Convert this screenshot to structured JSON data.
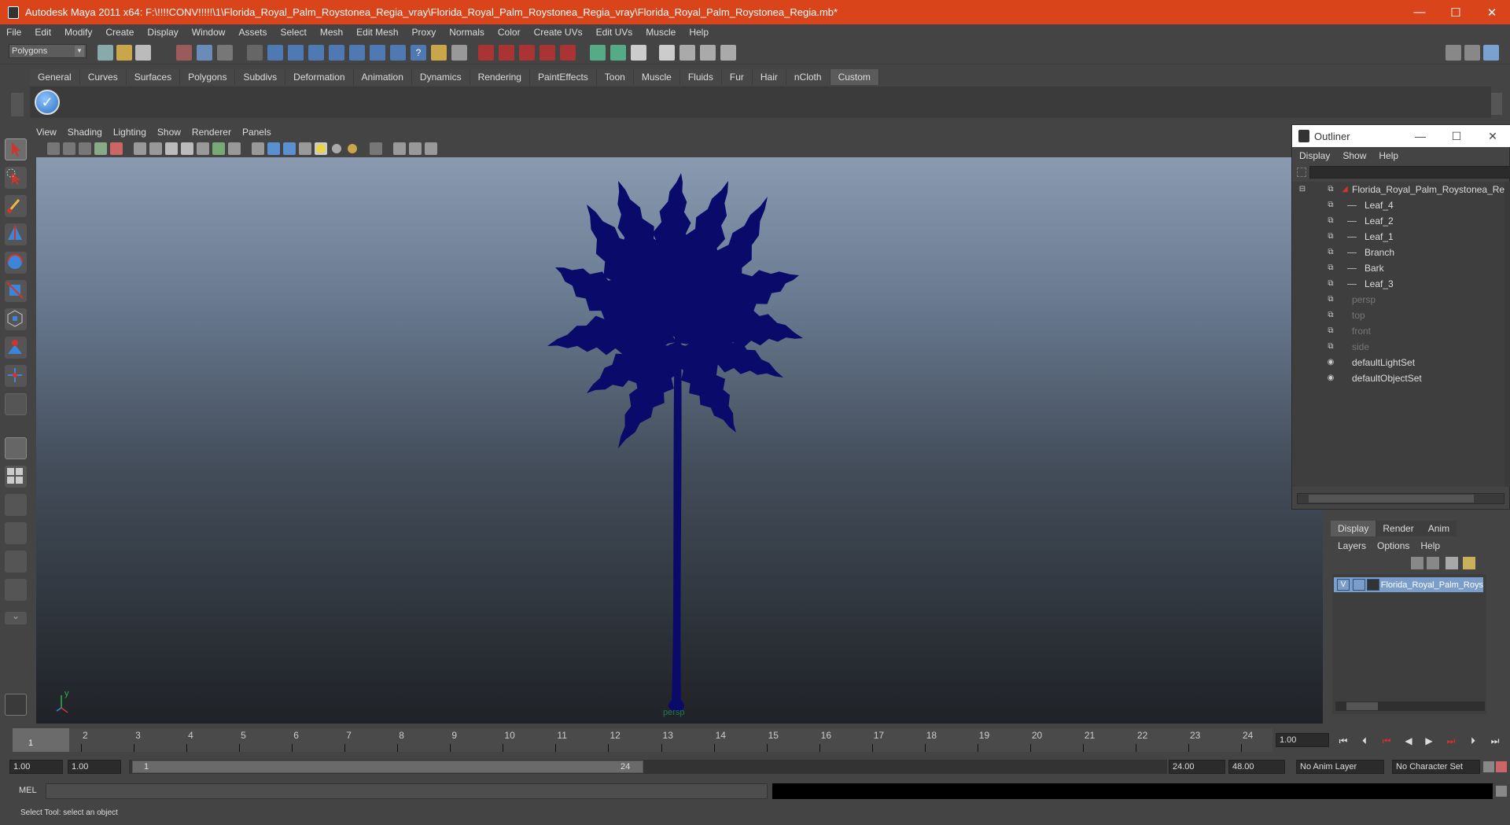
{
  "window": {
    "title": "Autodesk Maya 2011 x64: F:\\!!!!CONV!!!!!\\1\\Florida_Royal_Palm_Roystonea_Regia_vray\\Florida_Royal_Palm_Roystonea_Regia_vray\\Florida_Royal_Palm_Roystonea_Regia.mb*",
    "minimize": "—",
    "maximize": "☐",
    "close": "✕"
  },
  "menubar": [
    "File",
    "Edit",
    "Modify",
    "Create",
    "Display",
    "Window",
    "Assets",
    "Select",
    "Mesh",
    "Edit Mesh",
    "Proxy",
    "Normals",
    "Color",
    "Create UVs",
    "Edit UVs",
    "Muscle",
    "Help"
  ],
  "statusline": {
    "mode": "Polygons"
  },
  "shelf": {
    "tabs": [
      "General",
      "Curves",
      "Surfaces",
      "Polygons",
      "Subdivs",
      "Deformation",
      "Animation",
      "Dynamics",
      "Rendering",
      "PaintEffects",
      "Toon",
      "Muscle",
      "Fluids",
      "Fur",
      "Hair",
      "nCloth",
      "Custom"
    ],
    "active_tab": "Custom"
  },
  "viewport": {
    "menu": [
      "View",
      "Shading",
      "Lighting",
      "Show",
      "Renderer",
      "Panels"
    ],
    "camera_label": "persp",
    "axis_y": "y",
    "wire_color": "#0a0a6b"
  },
  "outliner": {
    "title": "Outliner",
    "menu": [
      "Display",
      "Show",
      "Help"
    ],
    "items": [
      {
        "label": "Florida_Royal_Palm_Roystonea_Regia",
        "indent": 0,
        "dim": false,
        "expanded": true
      },
      {
        "label": "Leaf_4",
        "indent": 1,
        "dim": false
      },
      {
        "label": "Leaf_2",
        "indent": 1,
        "dim": false
      },
      {
        "label": "Leaf_1",
        "indent": 1,
        "dim": false
      },
      {
        "label": "Branch",
        "indent": 1,
        "dim": false
      },
      {
        "label": "Bark",
        "indent": 1,
        "dim": false
      },
      {
        "label": "Leaf_3",
        "indent": 1,
        "dim": false
      },
      {
        "label": "persp",
        "indent": 0,
        "dim": true
      },
      {
        "label": "top",
        "indent": 0,
        "dim": true
      },
      {
        "label": "front",
        "indent": 0,
        "dim": true
      },
      {
        "label": "side",
        "indent": 0,
        "dim": true
      },
      {
        "label": "defaultLightSet",
        "indent": 0,
        "dim": false
      },
      {
        "label": "defaultObjectSet",
        "indent": 0,
        "dim": false
      }
    ]
  },
  "layers": {
    "tabs": [
      "Display",
      "Render",
      "Anim"
    ],
    "active_tab": "Display",
    "menu": [
      "Layers",
      "Options",
      "Help"
    ],
    "rows": [
      {
        "visible": "V",
        "name": "Florida_Royal_Palm_Roys"
      }
    ]
  },
  "timeline": {
    "ticks": [
      "1",
      "2",
      "3",
      "4",
      "5",
      "6",
      "7",
      "8",
      "9",
      "10",
      "11",
      "12",
      "13",
      "14",
      "15",
      "16",
      "17",
      "18",
      "19",
      "20",
      "21",
      "22",
      "23",
      "24"
    ],
    "current_frame": "1",
    "current_frame_field": "1.00"
  },
  "range": {
    "start": "1.00",
    "playback_start": "1.00",
    "slider_start": "1",
    "slider_end": "24",
    "playback_end": "24.00",
    "end": "48.00",
    "anim_layer": "No Anim Layer",
    "character_set": "No Character Set"
  },
  "command": {
    "label": "MEL"
  },
  "help_line": "Select Tool: select an object"
}
